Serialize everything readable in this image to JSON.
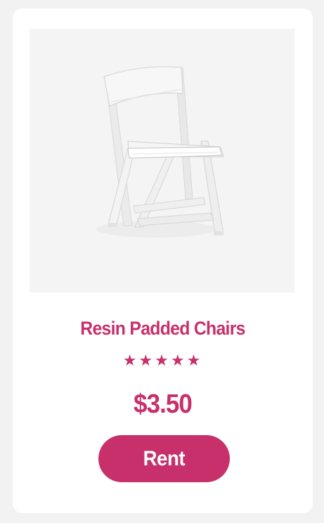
{
  "product": {
    "title": "Resin Padded Chairs",
    "rating_stars": "★★★★★",
    "rating": 5,
    "rating_max": 5,
    "price": "$3.50",
    "cta_label": "Rent",
    "image_alt_semantic": "white-folding-chair-image"
  },
  "colors": {
    "accent": "#c7306a",
    "page_bg": "#f2f2f2",
    "card_bg": "#ffffff",
    "image_bg": "#f4f4f4"
  }
}
